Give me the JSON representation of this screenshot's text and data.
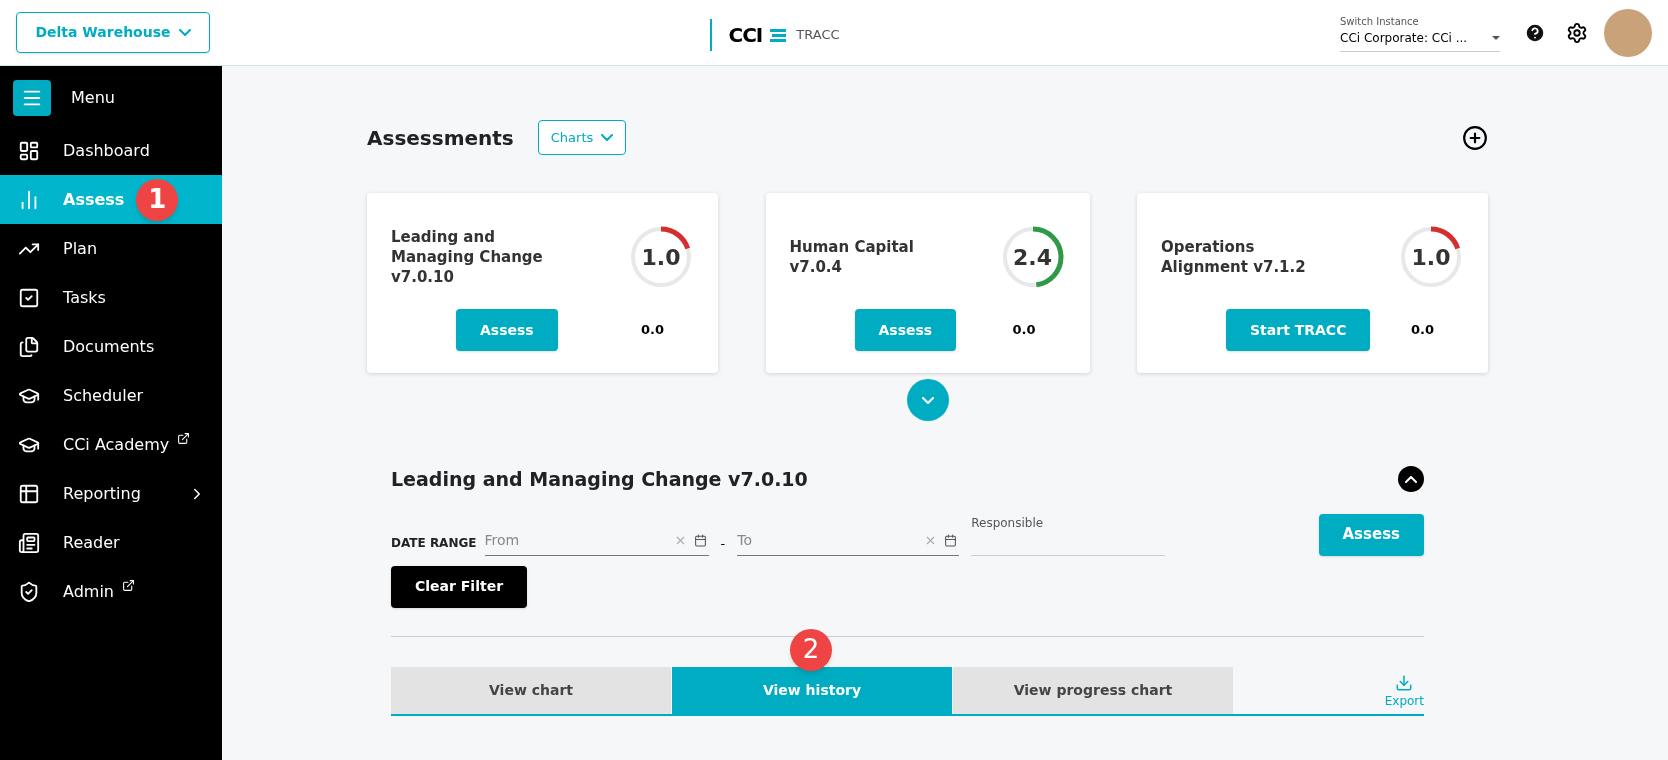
{
  "header": {
    "site_button": "Delta Warehouse",
    "logo": {
      "mark": "CCI",
      "product": "TRACC"
    },
    "instance": {
      "label": "Switch Instance",
      "value": "CCi Corporate: CCi ..."
    }
  },
  "sidebar": {
    "menu_label": "Menu",
    "items": [
      {
        "label": "Dashboard",
        "selected": false,
        "external": false,
        "submenu": false
      },
      {
        "label": "Assess",
        "selected": true,
        "external": false,
        "submenu": false,
        "callout": "1"
      },
      {
        "label": "Plan",
        "selected": false,
        "external": false,
        "submenu": false
      },
      {
        "label": "Tasks",
        "selected": false,
        "external": false,
        "submenu": false
      },
      {
        "label": "Documents",
        "selected": false,
        "external": false,
        "submenu": false
      },
      {
        "label": "Scheduler",
        "selected": false,
        "external": false,
        "submenu": false
      },
      {
        "label": "CCi Academy",
        "selected": false,
        "external": true,
        "submenu": false
      },
      {
        "label": "Reporting",
        "selected": false,
        "external": false,
        "submenu": true
      },
      {
        "label": "Reader",
        "selected": false,
        "external": false,
        "submenu": false
      },
      {
        "label": "Admin",
        "selected": false,
        "external": true,
        "submenu": false
      }
    ]
  },
  "assessments": {
    "title": "Assessments",
    "charts_button": "Charts",
    "cards": [
      {
        "title": "Leading and Managing Change v7.0.10",
        "score": "1.0",
        "level": 0.2,
        "color": "#d32f2f",
        "button": "Assess",
        "secondary": "0.0"
      },
      {
        "title": "Human Capital v7.0.4",
        "score": "2.4",
        "level": 0.48,
        "color": "#2e9a47",
        "button": "Assess",
        "secondary": "0.0"
      },
      {
        "title": "Operations Alignment v7.1.2",
        "score": "1.0",
        "level": 0.2,
        "color": "#d32f2f",
        "button": "Start TRACC",
        "secondary": "0.0"
      }
    ]
  },
  "detail": {
    "title": "Leading and Managing Change v7.0.10",
    "date_range_label": "DATE RANGE",
    "from": {
      "placeholder": "From"
    },
    "separator": "-",
    "to": {
      "placeholder": "To"
    },
    "responsible": {
      "label": "Responsible"
    },
    "assess_button": "Assess",
    "clear_button": "Clear Filter",
    "tabs": [
      {
        "label": "View chart",
        "selected": false
      },
      {
        "label": "View history",
        "selected": true,
        "callout": "2"
      },
      {
        "label": "View progress chart",
        "selected": false
      }
    ],
    "export": "Export"
  }
}
